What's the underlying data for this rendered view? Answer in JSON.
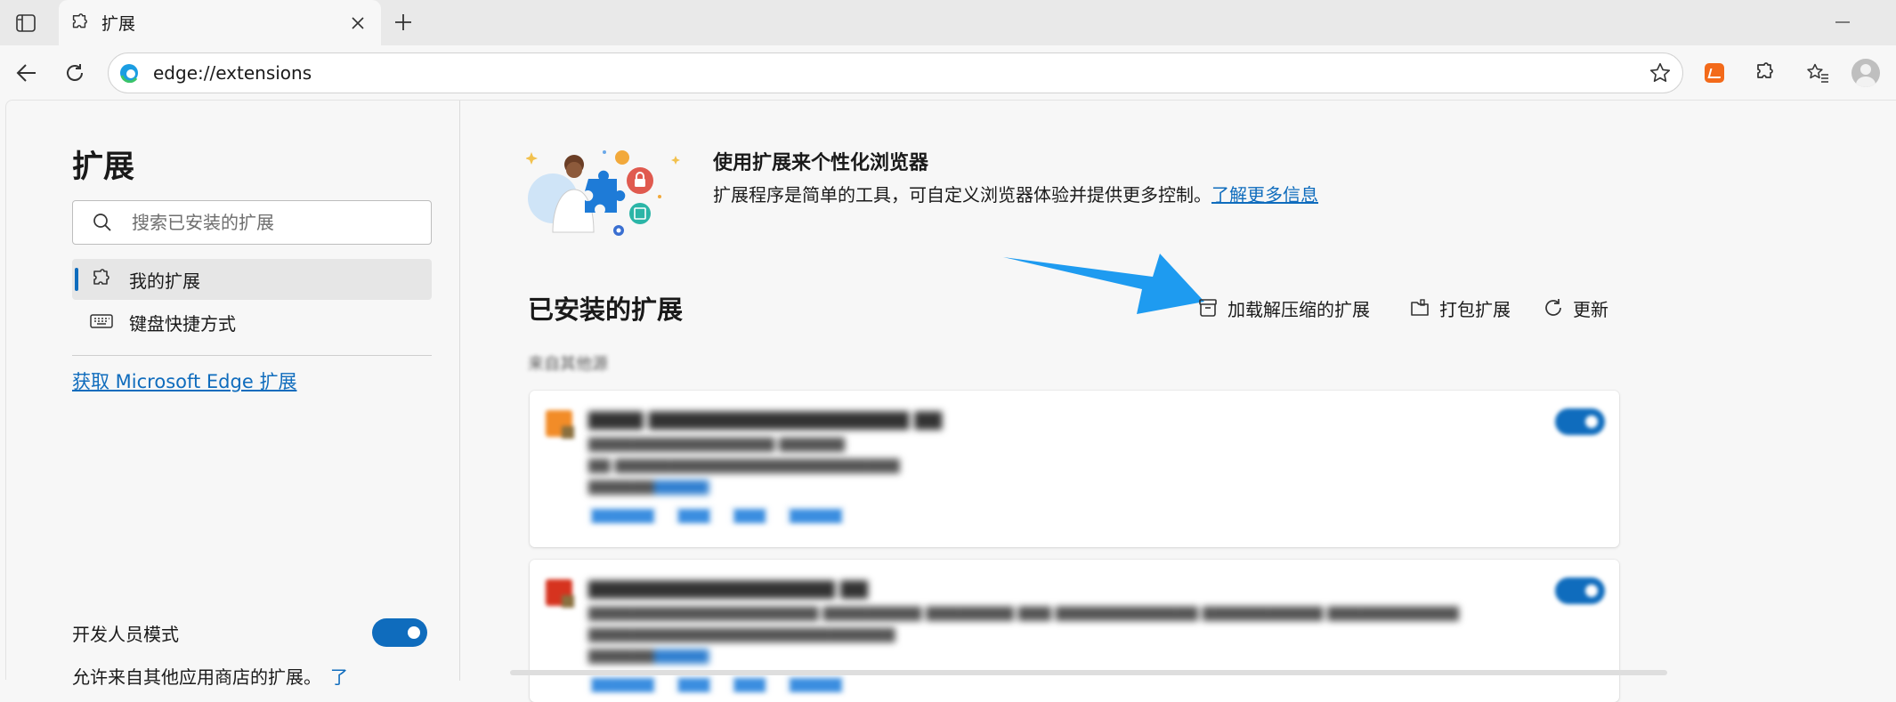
{
  "tab": {
    "title": "扩展"
  },
  "address_bar": {
    "url": "edge://extensions"
  },
  "sidebar": {
    "title": "扩展",
    "search_placeholder": "搜索已安装的扩展",
    "nav": [
      {
        "label": "我的扩展",
        "active": true
      },
      {
        "label": "键盘快捷方式",
        "active": false
      }
    ],
    "get_extensions_link": "获取 Microsoft Edge 扩展",
    "developer_mode": {
      "label": "开发人员模式",
      "enabled": true
    },
    "other_stores_label": "允许来自其他应用商店的扩展。",
    "other_stores_more": "了"
  },
  "intro": {
    "title": "使用扩展来个性化浏览器",
    "description": "扩展程序是简单的工具，可自定义浏览器体验并提供更多控制。",
    "learn_more": "了解更多信息"
  },
  "installed": {
    "title": "已安装的扩展",
    "actions": {
      "load_unpacked": "加载解压缩的扩展",
      "pack": "打包扩展",
      "update": "更新"
    },
    "source_label": "来自其他源",
    "extensions": [
      {
        "name": "▇▇▇▇ ▇▇▇▇▇▇▇▇▇▇▇▇▇▇▇▇▇▇▇ ▇▇",
        "line1": "▇▇▇▇▇▇▇▇▇▇▇▇▇▇▇▇▇ ▇▇▇▇▇▇",
        "line2": "▇▇ ▇▇▇▇▇▇▇▇▇▇▇▇▇▇▇▇▇▇▇▇▇▇▇▇▇▇",
        "id_label": "▇▇▇▇▇▇",
        "id_value": "▇▇▇▇▇",
        "links": [
          "▇▇▇▇▇▇",
          "▇▇▇",
          "▇▇▇",
          "▇▇▇▇▇"
        ],
        "logo_color": "#f28c28",
        "enabled": true
      },
      {
        "name": "▇▇▇▇▇▇▇▇▇▇▇▇▇▇▇▇▇▇ ▇▇",
        "line1": "▇▇▇▇▇▇▇▇▇▇▇▇▇▇▇▇▇▇▇▇▇ ▇▇▇▇▇▇▇▇▇ ▇▇▇▇▇▇▇▇ ▇▇▇ ▇▇▇▇▇▇▇▇▇▇▇▇▇ ▇▇▇▇▇▇▇▇▇▇▇ ▇▇▇▇▇▇▇▇▇▇▇▇",
        "line2": "▇▇▇▇▇▇▇▇▇▇▇▇▇▇▇▇▇▇▇▇▇▇▇▇▇▇▇▇",
        "id_label": "▇▇▇▇▇▇",
        "id_value": "▇▇▇▇▇",
        "links": [
          "▇▇▇▇▇▇",
          "▇▇▇",
          "▇▇▇",
          "▇▇▇▇▇"
        ],
        "logo_color": "#d6331f",
        "enabled": true
      }
    ]
  },
  "colors": {
    "accent": "#0f6cbd",
    "annotation_arrow": "#1e9bf0"
  }
}
